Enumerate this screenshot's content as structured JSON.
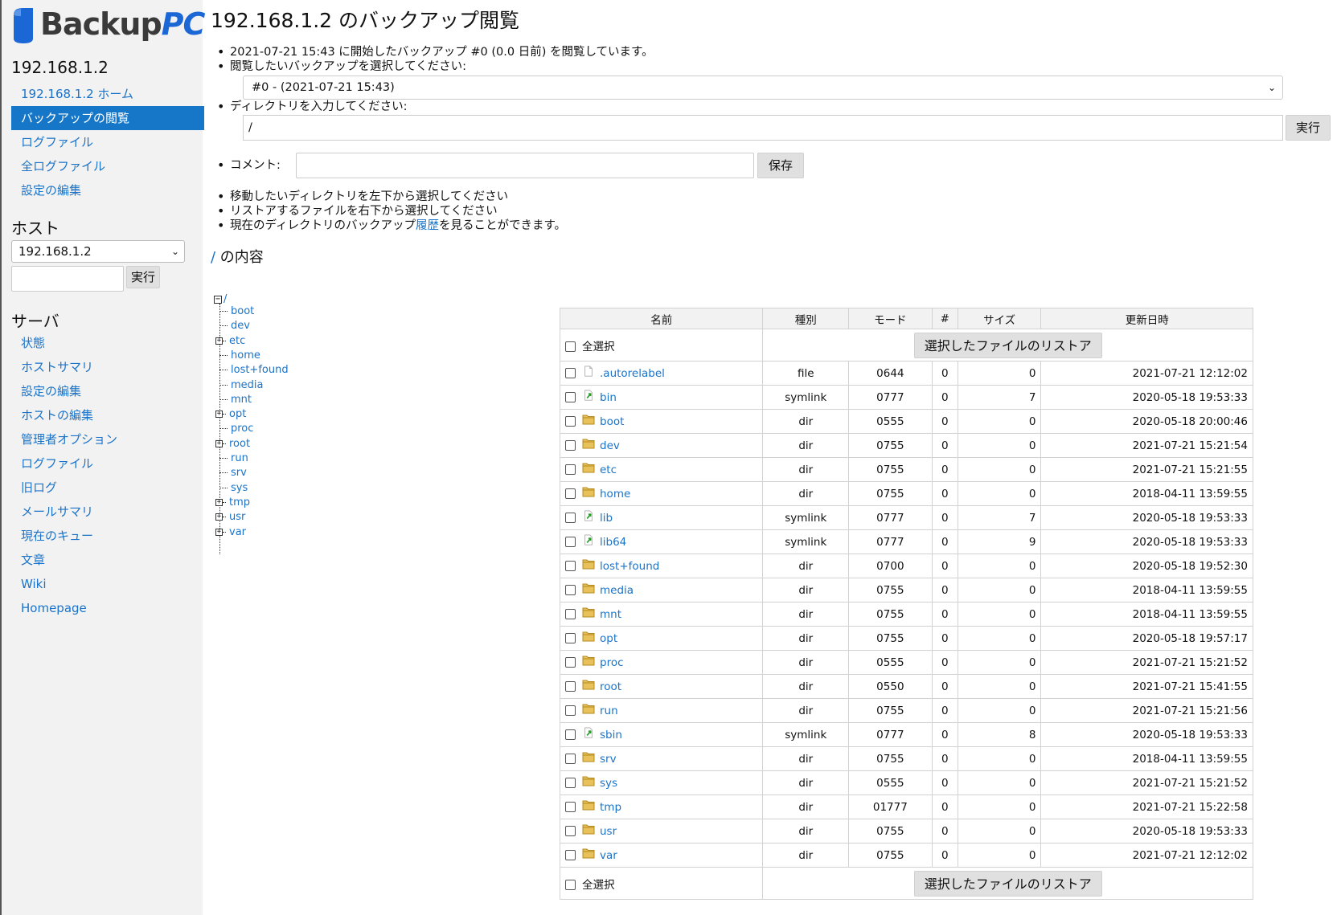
{
  "logo": {
    "word1": "Backup",
    "word2": "PC"
  },
  "sidebar": {
    "host_title": "192.168.1.2",
    "host_items": [
      {
        "label": "192.168.1.2 ホーム",
        "active": false
      },
      {
        "label": "バックアップの閲覧",
        "active": true
      },
      {
        "label": "ログファイル",
        "active": false
      },
      {
        "label": "全ログファイル",
        "active": false
      },
      {
        "label": "設定の編集",
        "active": false
      }
    ],
    "hosts_title": "ホスト",
    "host_select_value": "192.168.1.2",
    "host_go_label": "実行",
    "server_title": "サーバ",
    "server_items": [
      {
        "label": "状態"
      },
      {
        "label": "ホストサマリ"
      },
      {
        "label": "設定の編集"
      },
      {
        "label": "ホストの編集"
      },
      {
        "label": "管理者オプション"
      },
      {
        "label": "ログファイル"
      },
      {
        "label": "旧ログ"
      },
      {
        "label": "メールサマリ"
      },
      {
        "label": "現在のキュー"
      },
      {
        "label": "文章"
      },
      {
        "label": "Wiki"
      },
      {
        "label": "Homepage"
      }
    ]
  },
  "main": {
    "title": "192.168.1.2 のバックアップ閲覧",
    "browsing_text": "2021-07-21 15:43 に開始したバックアップ #0 (0.0 日前) を閲覧しています。",
    "select_backup_label": "閲覧したいバックアップを選択してください:",
    "backup_select_value": "#0 - (2021-07-21 15:43)",
    "dir_label": "ディレクトリを入力してください:",
    "dir_value": "/",
    "dir_go_label": "実行",
    "comment_label": "コメント:",
    "comment_value": "",
    "save_label": "保存",
    "hint1": "移動したいディレクトリを左下から選択してください",
    "hint2": "リストアするファイルを右下から選択してください",
    "hint3_pre": "現在のディレクトリのバックアップ",
    "hint3_link": "履歴",
    "hint3_post": "を見ることができます。",
    "contents_slash": "/",
    "contents_suffix": " の内容"
  },
  "tree": {
    "root": "/",
    "items": [
      {
        "name": "boot",
        "expandable": false
      },
      {
        "name": "dev",
        "expandable": false
      },
      {
        "name": "etc",
        "expandable": true
      },
      {
        "name": "home",
        "expandable": false
      },
      {
        "name": "lost+found",
        "expandable": false
      },
      {
        "name": "media",
        "expandable": false
      },
      {
        "name": "mnt",
        "expandable": false
      },
      {
        "name": "opt",
        "expandable": true
      },
      {
        "name": "proc",
        "expandable": false
      },
      {
        "name": "root",
        "expandable": true
      },
      {
        "name": "run",
        "expandable": false
      },
      {
        "name": "srv",
        "expandable": false
      },
      {
        "name": "sys",
        "expandable": false
      },
      {
        "name": "tmp",
        "expandable": true
      },
      {
        "name": "usr",
        "expandable": true
      },
      {
        "name": "var",
        "expandable": true
      }
    ]
  },
  "table": {
    "headers": [
      "名前",
      "種別",
      "モード",
      "#",
      "サイズ",
      "更新日時"
    ],
    "select_all_label": "全選択",
    "restore_label": "選択したファイルのリストア",
    "rows": [
      {
        "name": ".autorelabel",
        "type": "file",
        "mode": "0644",
        "num": "0",
        "size": "0",
        "date": "2021-07-21 12:12:02"
      },
      {
        "name": "bin",
        "type": "symlink",
        "mode": "0777",
        "num": "0",
        "size": "7",
        "date": "2020-05-18 19:53:33"
      },
      {
        "name": "boot",
        "type": "dir",
        "mode": "0555",
        "num": "0",
        "size": "0",
        "date": "2020-05-18 20:00:46"
      },
      {
        "name": "dev",
        "type": "dir",
        "mode": "0755",
        "num": "0",
        "size": "0",
        "date": "2021-07-21 15:21:54"
      },
      {
        "name": "etc",
        "type": "dir",
        "mode": "0755",
        "num": "0",
        "size": "0",
        "date": "2021-07-21 15:21:55"
      },
      {
        "name": "home",
        "type": "dir",
        "mode": "0755",
        "num": "0",
        "size": "0",
        "date": "2018-04-11 13:59:55"
      },
      {
        "name": "lib",
        "type": "symlink",
        "mode": "0777",
        "num": "0",
        "size": "7",
        "date": "2020-05-18 19:53:33"
      },
      {
        "name": "lib64",
        "type": "symlink",
        "mode": "0777",
        "num": "0",
        "size": "9",
        "date": "2020-05-18 19:53:33"
      },
      {
        "name": "lost+found",
        "type": "dir",
        "mode": "0700",
        "num": "0",
        "size": "0",
        "date": "2020-05-18 19:52:30"
      },
      {
        "name": "media",
        "type": "dir",
        "mode": "0755",
        "num": "0",
        "size": "0",
        "date": "2018-04-11 13:59:55"
      },
      {
        "name": "mnt",
        "type": "dir",
        "mode": "0755",
        "num": "0",
        "size": "0",
        "date": "2018-04-11 13:59:55"
      },
      {
        "name": "opt",
        "type": "dir",
        "mode": "0755",
        "num": "0",
        "size": "0",
        "date": "2020-05-18 19:57:17"
      },
      {
        "name": "proc",
        "type": "dir",
        "mode": "0555",
        "num": "0",
        "size": "0",
        "date": "2021-07-21 15:21:52"
      },
      {
        "name": "root",
        "type": "dir",
        "mode": "0550",
        "num": "0",
        "size": "0",
        "date": "2021-07-21 15:41:55"
      },
      {
        "name": "run",
        "type": "dir",
        "mode": "0755",
        "num": "0",
        "size": "0",
        "date": "2021-07-21 15:21:56"
      },
      {
        "name": "sbin",
        "type": "symlink",
        "mode": "0777",
        "num": "0",
        "size": "8",
        "date": "2020-05-18 19:53:33"
      },
      {
        "name": "srv",
        "type": "dir",
        "mode": "0755",
        "num": "0",
        "size": "0",
        "date": "2018-04-11 13:59:55"
      },
      {
        "name": "sys",
        "type": "dir",
        "mode": "0555",
        "num": "0",
        "size": "0",
        "date": "2021-07-21 15:21:52"
      },
      {
        "name": "tmp",
        "type": "dir",
        "mode": "01777",
        "num": "0",
        "size": "0",
        "date": "2021-07-21 15:22:58"
      },
      {
        "name": "usr",
        "type": "dir",
        "mode": "0755",
        "num": "0",
        "size": "0",
        "date": "2020-05-18 19:53:33"
      },
      {
        "name": "var",
        "type": "dir",
        "mode": "0755",
        "num": "0",
        "size": "0",
        "date": "2021-07-21 12:12:02"
      }
    ]
  },
  "colors": {
    "link": "#1a73c9",
    "active_bg": "#1677c8",
    "sidebar_bg": "#f2f2f2",
    "logo_blue": "#1b67d6",
    "folder": "#e8c15a"
  }
}
